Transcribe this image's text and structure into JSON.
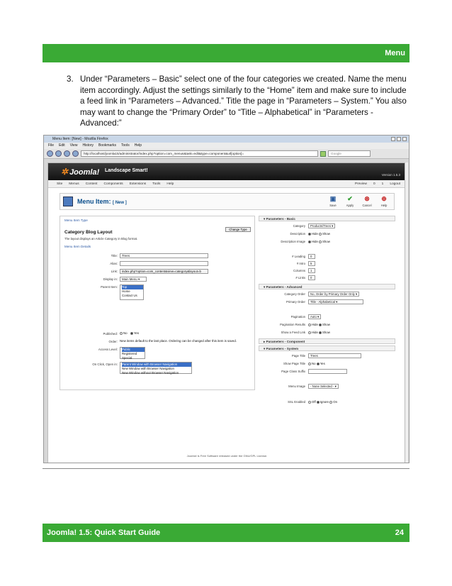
{
  "header": {
    "section": "Menu"
  },
  "step": {
    "number": "3.",
    "text": "Under “Parameters – Basic” select one of the four categories we created.  Name the menu item accordingly.  Adjust the settings similarly to the “Home” item and make sure to include a feed link in “Parameters – Advanced.”  Title the page in “Parameters – System.”  You also may want to change the “Primary Order” to “Title – Alphabetical” in “Parameters - Advanced:”"
  },
  "browser": {
    "title": "Menu Item: [New] - Mozilla Firefox",
    "menu": [
      "File",
      "Edit",
      "View",
      "History",
      "Bookmarks",
      "Tools",
      "Help"
    ],
    "url": "http://localhost/joomla15/administrator/index.php?option=com_menus&task=edit&type=component&url[option]=",
    "search_placeholder": "Google"
  },
  "joomla": {
    "brand": "Joomla!",
    "site": "Landscape Smart!",
    "version": "Version 1.5.3",
    "menubar": [
      "Site",
      "Menus",
      "Content",
      "Components",
      "Extensions",
      "Tools",
      "Help"
    ],
    "menubar_right": [
      "Preview",
      "0",
      "1",
      "Logout"
    ],
    "page_title": "Menu Item:",
    "page_title_suffix": "[ New ]",
    "buttons": [
      "Save",
      "Apply",
      "Cancel",
      "Help"
    ],
    "left": {
      "type_legend": "Menu Item Type",
      "type_name": "Category Blog Layout",
      "change_type": "Change Type",
      "type_desc": "The layout displays an Article Category in Blog format.",
      "details_legend": "Menu Item Details",
      "fields": [
        {
          "label": "Title:",
          "value": "Trees"
        },
        {
          "label": "Alias:",
          "value": ""
        },
        {
          "label": "Link:",
          "value": "index.php?option=com_content&view=category&layout=b"
        },
        {
          "label": "Display in:",
          "value": "Main Menu"
        }
      ],
      "parent_label": "Parent Item:",
      "parent_options": [
        "Top",
        "Home",
        "Contact Us"
      ],
      "published_label": "Published:",
      "published_options": [
        "No",
        "Yes"
      ],
      "order_label": "Order:",
      "order_text": "New items default to the last place. Ordering can be changed after this item is saved.",
      "access_label": "Access Level:",
      "access_options": [
        "Public",
        "Registered",
        "Special"
      ],
      "onclick_label": "On Click, Open in:",
      "onclick_options": [
        "Parent Window with Browser Navigation",
        "New Window with Browser Navigation",
        "New Window without Browser Navigation"
      ]
    },
    "right": {
      "basic_title": "Parameters - Basic",
      "category_label": "Category",
      "category_value": "Products/Trees",
      "description_label": "Description",
      "desc_image_label": "Description Image",
      "hide": "Hide",
      "show": "Show",
      "leading_label": "# Leading",
      "leading_value": "0",
      "intro_label": "# Intro",
      "intro_value": "5",
      "columns_label": "Columns",
      "columns_value": "1",
      "links_label": "# Links",
      "links_value": "0",
      "advanced_title": "Parameters - Advanced",
      "cat_order_label": "Category Order",
      "cat_order_value": "No, Order by Primary Order Only",
      "primary_order_label": "Primary Order",
      "primary_order_value": "Title - Alphabetical",
      "pagination_label": "Pagination",
      "pagination_value": "Auto",
      "pag_results_label": "Pagination Results",
      "feed_label": "Show a Feed Link",
      "component_title": "Parameters - Component",
      "system_title": "Parameters - System",
      "page_title_label": "Page Title",
      "page_title_value": "Trees",
      "show_page_title_label": "Show Page Title",
      "no": "No",
      "yes": "Yes",
      "suffix_label": "Page Class Suffix",
      "menu_image_label": "Menu Image",
      "menu_image_value": "- None Selected -",
      "ssl_label": "SSL Enabled",
      "off": "Off",
      "ignore": "Ignore",
      "on": "On"
    },
    "footer": "Joomla! is Free Software released under the GNU/GPL License."
  },
  "footer": {
    "guide": "Joomla! 1.5: Quick Start Guide",
    "page": "24"
  }
}
